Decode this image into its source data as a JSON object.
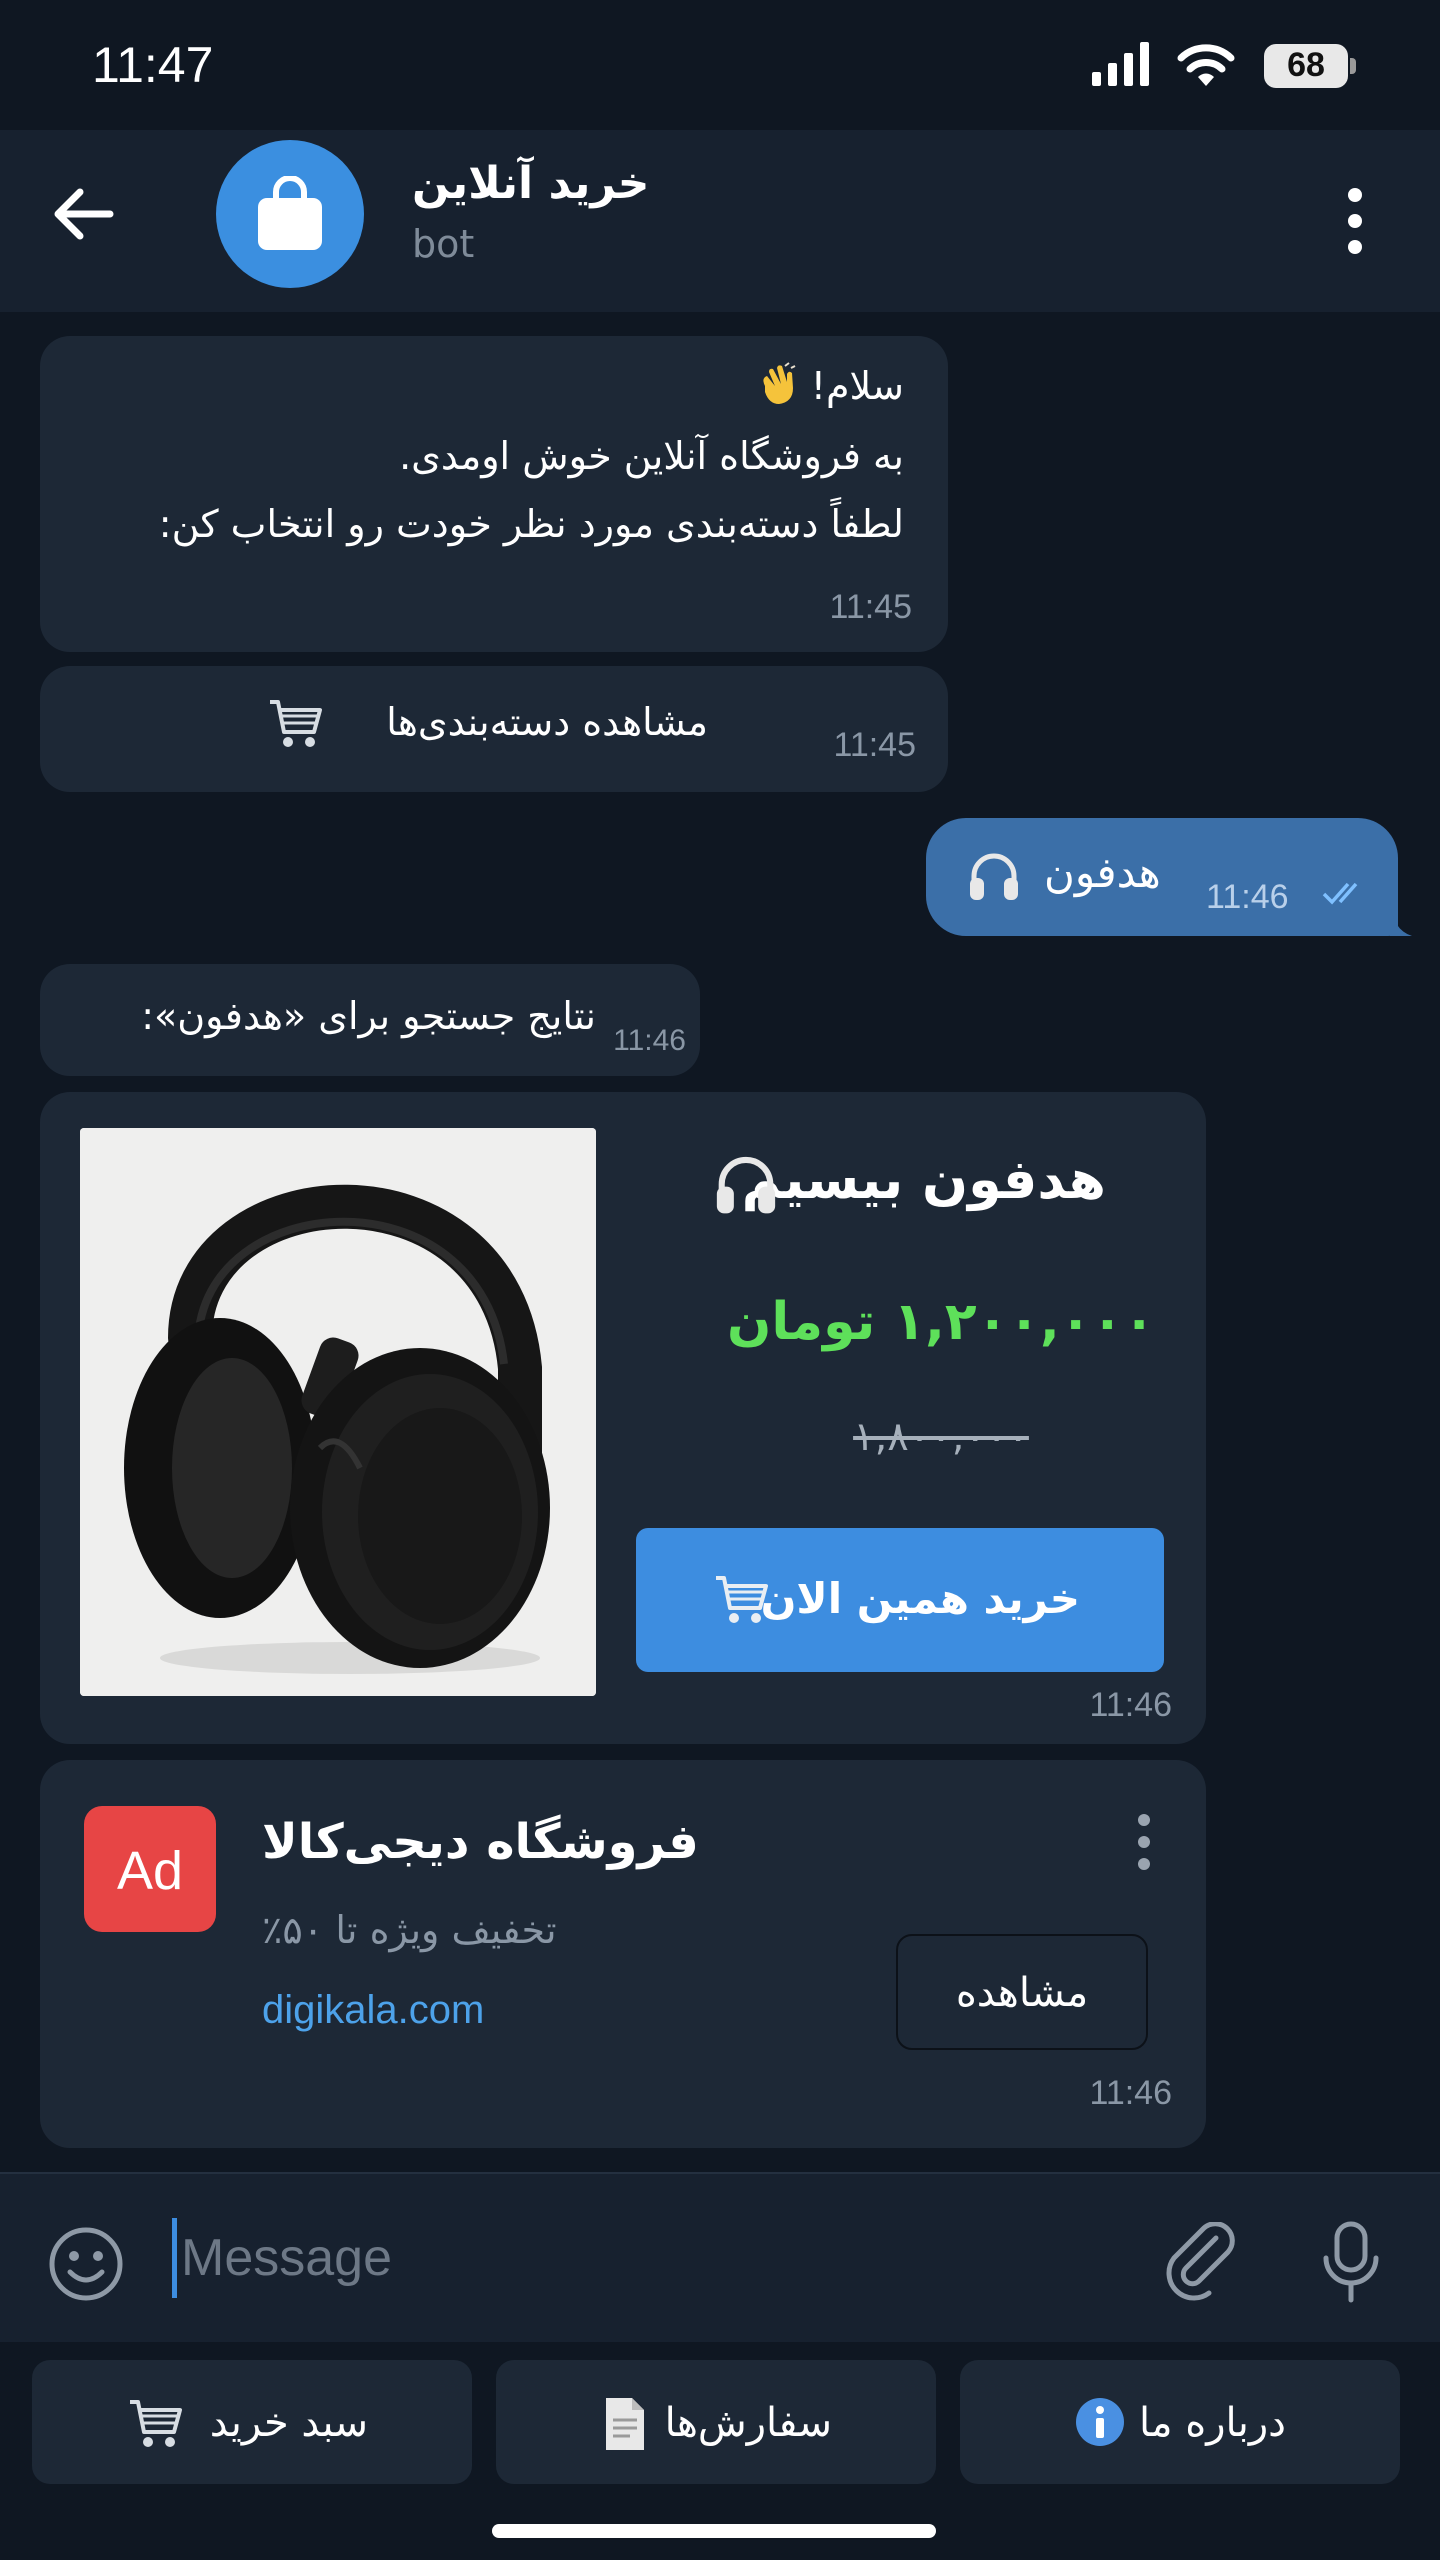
{
  "status_bar": {
    "time": "11:47",
    "battery": "68"
  },
  "header": {
    "title": "خرید آنلاین",
    "subtitle": "bot"
  },
  "messages": {
    "welcome": {
      "line1": "سلام!",
      "line2": "به فروشگاه آنلاین خوش اومدی.",
      "line3": "لطفاً دسته‌بندی مورد نظر خودت رو انتخاب کن:",
      "time": "11:45"
    },
    "categories": {
      "label": "مشاهده دسته‌بندی‌ها",
      "time": "11:45"
    },
    "outgoing": {
      "text": "هدفون",
      "time": "11:46"
    },
    "search": {
      "text": "نتایج جستجو برای «هدفون»:",
      "time": "11:46"
    },
    "product": {
      "name": "هدفون بیسیم",
      "price": "۱,۲۰۰,۰۰۰ تومان",
      "old_price": "۱,۸۰۰,۰۰۰",
      "buy_label": "خرید همین الان",
      "time": "11:46"
    },
    "ad": {
      "badge": "Ad",
      "title": "فروشگاه دیجی‌کالا",
      "subtitle": "تخفیف ویژه تا ۵۰٪",
      "link": "digikala.com",
      "button": "مشاهده",
      "time": "11:46"
    }
  },
  "input": {
    "placeholder": "Message"
  },
  "keyboard": {
    "cart": "سبد خرید",
    "orders": "سفارش‌ها",
    "about": "درباره ما"
  },
  "colors": {
    "background": "#0f1722",
    "header": "#17212f",
    "bubble": "#1d2836",
    "outgoing": "#3b6fa8",
    "accent": "#3d8de0",
    "price": "#5ee05a",
    "ad_badge": "#e74545"
  },
  "icons": [
    "back-arrow-icon",
    "shopping-bag-icon",
    "more-vertical-icon",
    "waving-hand-icon",
    "shopping-cart-icon",
    "headphones-icon",
    "double-check-icon",
    "emoji-icon",
    "paperclip-icon",
    "microphone-icon",
    "document-icon",
    "info-icon"
  ]
}
